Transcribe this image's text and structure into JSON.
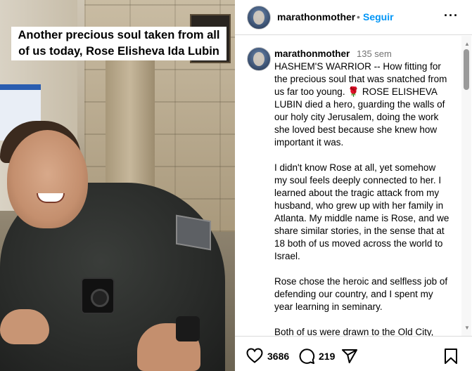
{
  "media": {
    "caption": "Another precious soul taken from all of us today, Rose  Elisheva Ida Lubin"
  },
  "header": {
    "username": "marathonmother",
    "separator": "•",
    "follow_label": "Seguir",
    "more_label": "···"
  },
  "comment": {
    "username": "marathonmother",
    "time": "135 sem",
    "text": "HASHEM'S WARRIOR -- How fitting for the precious soul that was snatched from us far too young. 🌹 ROSE ELISHEVA LUBIN died a hero, guarding the walls of our holy city Jerusalem, doing the work she loved best because she knew how important it was.\n\nI didn't know Rose at all, yet somehow my soul feels deeply connected to her. I learned about the tragic attack from my husband, who grew up with her family in Atlanta. My middle name is Rose, and we share similar stories, in the sense that at 18 both of us moved across the world to Israel.\n\nRose chose the heroic and selfless job of defending our country, and I spent my year learning in seminary.\n\nBoth of us were drawn to the Old City,"
  },
  "actions": {
    "like_count": "3686",
    "comment_count": "219",
    "icons": [
      "heart-icon",
      "comment-icon",
      "share-icon",
      "bookmark-icon"
    ]
  },
  "scrollbar": {
    "up_arrow": "▲",
    "down_arrow": "▼"
  },
  "colors": {
    "link": "#0095f6",
    "muted": "#737373",
    "divider": "#dbdbdb"
  }
}
